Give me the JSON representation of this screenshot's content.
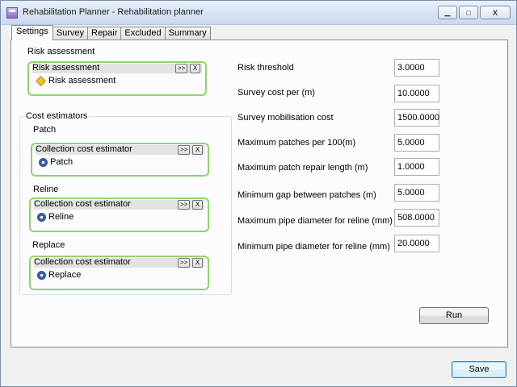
{
  "window": {
    "title": "Rehabilitation Planner - Rehabilitation planner"
  },
  "caption": {
    "minimize": "▁",
    "maximize": "□",
    "close": "X"
  },
  "tabs": [
    "Settings",
    "Survey",
    "Repair",
    "Excluded",
    "Summary"
  ],
  "risk_section": {
    "heading": "Risk assessment",
    "box_header": "Risk assessment",
    "item": "Risk assessment",
    "item_icon": "risk-assessment-icon"
  },
  "cost_estimators": {
    "group_title": "Cost estimators",
    "patch": {
      "heading": "Patch",
      "box_header": "Collection cost estimator",
      "item": "Patch"
    },
    "reline": {
      "heading": "Reline",
      "box_header": "Collection cost estimator",
      "item": "Reline"
    },
    "replace": {
      "heading": "Replace",
      "box_header": "Collection cost estimator",
      "item": "Replace"
    }
  },
  "box_buttons": {
    "expand": ">>",
    "remove": "X"
  },
  "parameters": [
    {
      "label": "Risk threshold",
      "value": "3.0000"
    },
    {
      "label": "Survey cost per (m)",
      "value": "10.0000"
    },
    {
      "label": "Survey mobilisation cost",
      "value": "1500.0000"
    },
    {
      "label": "Maximum patches per 100(m)",
      "value": "5.0000"
    },
    {
      "label": "Maximum patch repair length (m)",
      "value": "1.0000"
    },
    {
      "label": "Minimum gap between patches (m)",
      "value": "5.0000"
    },
    {
      "label": "Maximum pipe diameter for reline (mm)",
      "value": "508.0000"
    },
    {
      "label": "Minimum pipe diameter for reline (mm)",
      "value": "20.0000"
    }
  ],
  "run_button": "Run",
  "save_button": "Save",
  "colors": {
    "box_border": "#8fd46a",
    "focus_border": "#3c7fb1"
  }
}
